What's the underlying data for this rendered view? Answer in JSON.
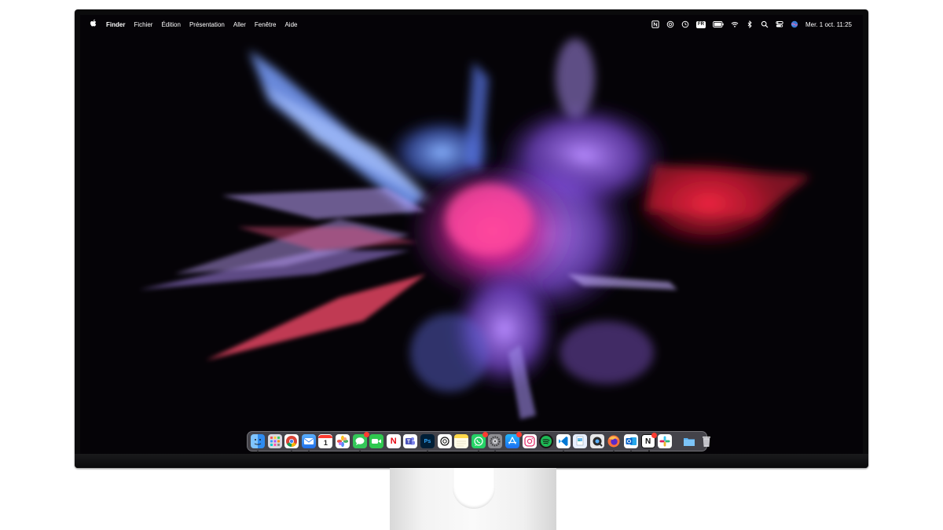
{
  "menubar": {
    "apple_icon": "apple-logo-icon",
    "app_name": "Finder",
    "items": [
      "Fichier",
      "Édition",
      "Présentation",
      "Aller",
      "Fenêtre",
      "Aide"
    ],
    "status": {
      "input_language": "FR",
      "clock": "Mer. 1 oct.  11:25"
    }
  },
  "dock": {
    "apps": [
      {
        "name": "finder-icon",
        "color": "#2f8bf0"
      },
      {
        "name": "launchpad-icon",
        "color": "#d8d8e0"
      },
      {
        "name": "chrome-icon",
        "color": "#ffffff"
      },
      {
        "name": "mail-icon",
        "color": "#2f7df6"
      },
      {
        "name": "calendar-icon",
        "color": "#ffffff",
        "text": "1"
      },
      {
        "name": "photos-icon",
        "color": "#ffffff"
      },
      {
        "name": "messages-icon",
        "color": "#34c759"
      },
      {
        "name": "facetime-icon",
        "color": "#2fc84f"
      },
      {
        "name": "netflix-icon",
        "color": "#e50914",
        "text": "N"
      },
      {
        "name": "teams-icon",
        "color": "#ffffff"
      },
      {
        "name": "photoshop-icon",
        "color": "#001e36",
        "text": "Ps"
      },
      {
        "name": "chatgpt-icon",
        "color": "#ffffff"
      },
      {
        "name": "notes-icon",
        "color": "#ffd84a"
      },
      {
        "name": "whatsapp-icon",
        "color": "#25d366"
      },
      {
        "name": "system-settings-icon",
        "color": "#8e8e93"
      },
      {
        "name": "app-store-icon",
        "color": "#1d8df3"
      },
      {
        "name": "instagram-icon",
        "color": "#e1306c"
      },
      {
        "name": "spotify-icon",
        "color": "#191414"
      },
      {
        "name": "vscode-icon",
        "color": "#0078d4"
      },
      {
        "name": "preview-icon",
        "color": "#e8f0ff"
      },
      {
        "name": "quicktime-icon",
        "color": "#2b2b2b"
      },
      {
        "name": "firefox-icon",
        "color": "#ff7139"
      },
      {
        "name": "outlook-icon",
        "color": "#0a64c9"
      },
      {
        "name": "notion-icon",
        "color": "#ffffff",
        "text": "N"
      },
      {
        "name": "slack-icon",
        "color": "#ffffff"
      }
    ],
    "trailing": [
      {
        "name": "downloads-folder-icon",
        "color": "#5ab0f0"
      },
      {
        "name": "trash-icon",
        "color": "#d0d0d6"
      }
    ]
  }
}
